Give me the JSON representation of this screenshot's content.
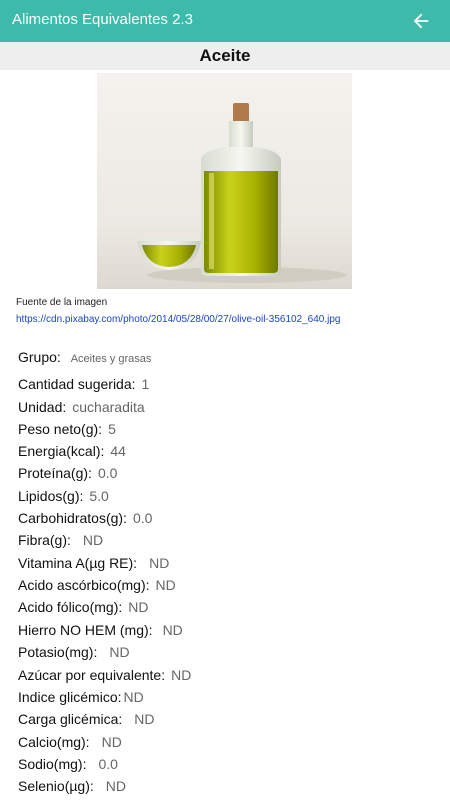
{
  "app": {
    "title": "Alimentos Equivalentes 2.3"
  },
  "food": {
    "name": "Aceite"
  },
  "image": {
    "credit_label": "Fuente de la imagen",
    "credit_url": "https://cdn.pixabay.com/photo/2014/05/28/00/27/olive-oil-356102_640.jpg"
  },
  "details": {
    "grupo_label": "Grupo:",
    "grupo_value": "Aceites y grasas",
    "cantidad_label": "Cantidad sugerida:",
    "cantidad_value": "1",
    "unidad_label": "Unidad:",
    "unidad_value": "cucharadita",
    "peso_label": "Peso neto(g):",
    "peso_value": "5",
    "energia_label": "Energia(kcal):",
    "energia_value": "44",
    "proteina_label": "Proteína(g):",
    "proteina_value": "0.0",
    "lipidos_label": "Lipidos(g):",
    "lipidos_value": "5.0",
    "carbohidratos_label": "Carbohidratos(g):",
    "carbohidratos_value": "0.0",
    "fibra_label": "Fibra(g):",
    "fibra_value": "ND",
    "vitamina_a_label": "Vitamina A(µg RE):",
    "vitamina_a_value": "ND",
    "ascorbico_label": "Acido ascórbico(mg):",
    "ascorbico_value": "ND",
    "folico_label": "Acido fólico(mg):",
    "folico_value": "ND",
    "hierro_label": "Hierro NO HEM (mg):",
    "hierro_value": "ND",
    "potasio_label": "Potasio(mg):",
    "potasio_value": "ND",
    "azucar_label": "Azúcar por equivalente:",
    "azucar_value": "ND",
    "indice_label": "Indice glicémico:",
    "indice_value": "ND",
    "carga_label": "Carga glicémica:",
    "carga_value": "ND",
    "calcio_label": "Calcio(mg):",
    "calcio_value": "ND",
    "sodio_label": "Sodio(mg):",
    "sodio_value": "0.0",
    "selenio_label": "Selenio(µg):",
    "selenio_value": "ND"
  },
  "icons": {
    "back": "arrow-left-icon",
    "image": "olive-oil-photo"
  },
  "colors": {
    "appbar": "#3dbaa9",
    "link": "#1a46c8",
    "value_text": "#666666"
  }
}
